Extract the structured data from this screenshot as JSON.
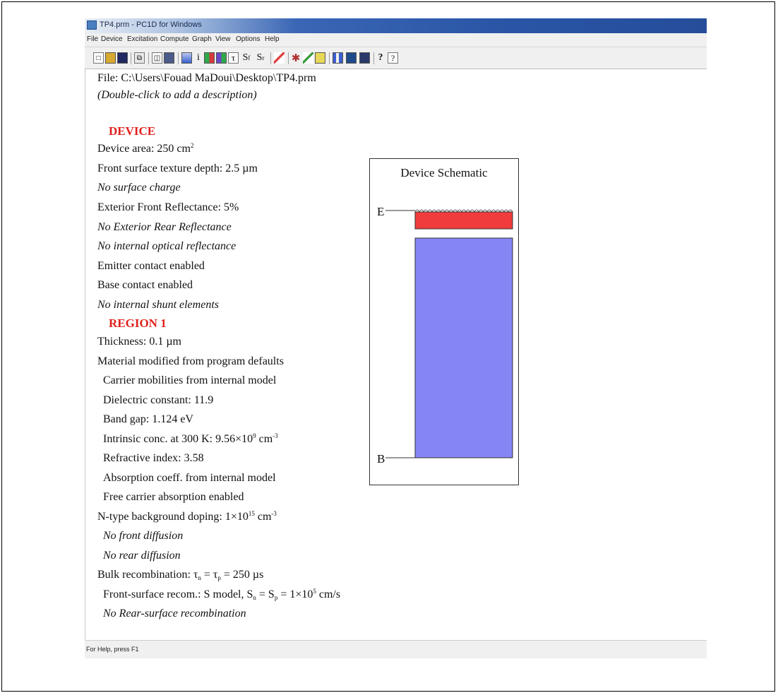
{
  "window": {
    "title": "TP4.prm - PC1D for Windows"
  },
  "menu": [
    "File",
    "Device",
    "Excitation",
    "Compute",
    "Graph",
    "View",
    "Options",
    "Help"
  ],
  "toolbar": {
    "s_front_label": "S",
    "s_front_sub": "f",
    "s_rear_label": "S",
    "s_rear_sub": "r",
    "tau_label": "τ",
    "info_label": "i",
    "help_label": "?",
    "context_help_label": "?",
    "icons": [
      "new-file",
      "open-folder",
      "save",
      "copy",
      "print-preview",
      "print",
      "device-view",
      "info",
      "excitation-chart",
      "graph-chart",
      "lifetime-tau",
      "front-surface-s",
      "rear-surface-s",
      "curve",
      "run-single",
      "run-batch",
      "run-step",
      "view-schematic",
      "view-results",
      "view-graph",
      "help",
      "context-help"
    ]
  },
  "file": {
    "path": "File: C:\\Users\\Fouad MaDoui\\Desktop\\TP4.prm",
    "description_hint": "(Double-click to add a description)"
  },
  "device": {
    "header": "DEVICE",
    "area_prefix": "Device area: 250 cm",
    "area_exp": "2",
    "texture": "Front surface texture depth: 2.5 µm",
    "surface_charge": "No surface charge",
    "front_reflectance": "Exterior Front Reflectance: 5%",
    "rear_reflectance": "No Exterior Rear Reflectance",
    "internal_reflectance": "No internal optical reflectance",
    "emitter_contact": "Emitter contact enabled",
    "base_contact": "Base contact enabled",
    "shunt": "No internal shunt elements"
  },
  "region1": {
    "header": "REGION 1",
    "thickness": "Thickness: 0.1 µm",
    "material": "Material modified from program defaults",
    "mobilities": "Carrier mobilities from internal model",
    "dielectric": "Dielectric constant: 11.9",
    "band_gap": "Band gap: 1.124 eV",
    "intrinsic_prefix": "Intrinsic conc. at 300 K: 9.56×10",
    "intrinsic_exp": "9",
    "intrinsic_unit": " cm",
    "intrinsic_unit_exp": "-3",
    "refractive": "Refractive index: 3.58",
    "absorption": "Absorption coeff. from internal model",
    "free_carrier": "Free carrier absorption enabled",
    "doping_prefix": "N-type background doping: 1×10",
    "doping_exp": "15",
    "doping_unit": " cm",
    "doping_unit_exp": "-3",
    "front_diffusion": "No front diffusion",
    "rear_diffusion": "No rear diffusion",
    "bulk_prefix": "Bulk recombination: τ",
    "bulk_sub1": "n",
    "bulk_mid": " = τ",
    "bulk_sub2": "p",
    "bulk_suffix": " = 250 µs",
    "front_recom_prefix": "Front-surface recom.:  S model, S",
    "front_recom_sub1": "n",
    "front_recom_mid": " = S",
    "front_recom_sub2": "p",
    "front_recom_val": " = 1×10",
    "front_recom_exp": "5",
    "front_recom_unit": " cm/s",
    "rear_recom": "No Rear-surface recombination"
  },
  "schematic": {
    "title": "Device Schematic",
    "emitter_label": "E",
    "base_label": "B",
    "emitter_color": "#f03c3c",
    "base_color": "#8585f5"
  },
  "status": {
    "text": "For Help, press F1"
  }
}
